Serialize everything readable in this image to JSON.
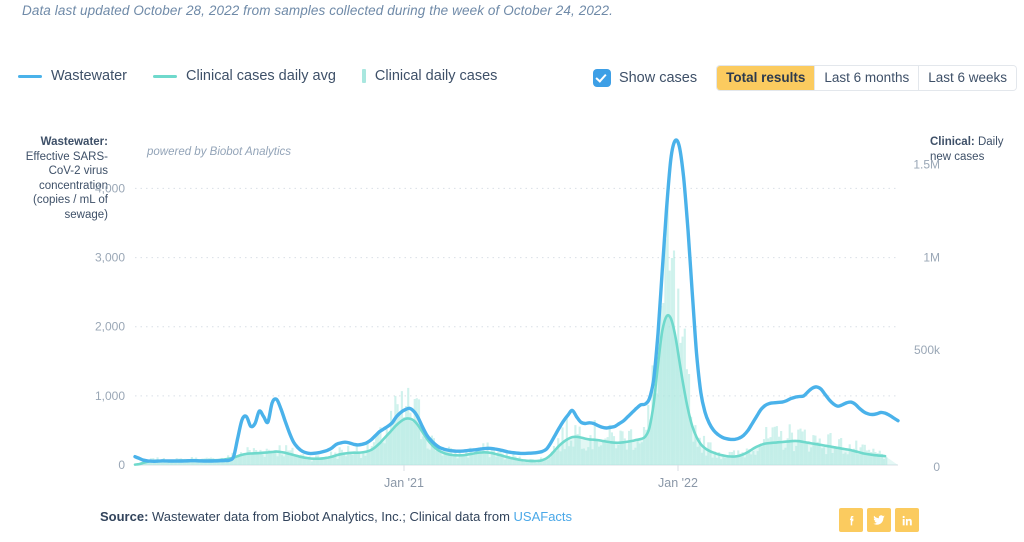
{
  "header": {
    "updated_note": "Data last updated October 28, 2022 from samples collected during the week of October 24, 2022."
  },
  "legend": {
    "items": [
      {
        "label": "Wastewater",
        "marker": "line",
        "color": "#4ab2ea"
      },
      {
        "label": "Clinical cases daily avg",
        "marker": "line",
        "color": "#6fd9cc"
      },
      {
        "label": "Clinical daily cases",
        "marker": "bar",
        "color": "#a9e7df"
      }
    ]
  },
  "controls": {
    "show_cases_label": "Show cases",
    "show_cases_checked": true,
    "range_buttons": [
      {
        "label": "Total results",
        "active": true
      },
      {
        "label": "Last 6 months",
        "active": false
      },
      {
        "label": "Last 6 weeks",
        "active": false
      }
    ],
    "active_color": "#fbcb5f"
  },
  "chart_attribution": "powered by Biobot Analytics",
  "footer": {
    "source_label": "Source:",
    "source_text": " Wastewater data from Biobot Analytics, Inc.; Clinical data from ",
    "source_link": "USAFacts",
    "socials": [
      {
        "name": "facebook-icon"
      },
      {
        "name": "twitter-icon"
      },
      {
        "name": "linkedin-icon"
      }
    ]
  },
  "chart_data": {
    "type": "line",
    "title": "",
    "subtitle": "",
    "xlabel": "",
    "ylabel": "Wastewater: Effective SARS-CoV-2 virus concentration (copies / mL of sewage)",
    "y2label": "Clinical: Daily new cases",
    "ylabel_title_bold": "Wastewater:",
    "ylabel_title_rest": "Effective SARS-CoV-2 virus concentration (copies / mL of sewage)",
    "y2label_title_bold": "Clinical:",
    "y2label_title_rest": "Daily new cases",
    "grid": true,
    "legend_position": "top-left",
    "ylim": [
      0,
      4700
    ],
    "y2lim": [
      0,
      1750000
    ],
    "yticks": [
      0,
      1000,
      2000,
      3000,
      4000
    ],
    "yticklabels": [
      "0",
      "1,000",
      "2,000",
      "3,000",
      "4,000"
    ],
    "y2ticks": [
      0,
      500000,
      1000000,
      1500000
    ],
    "y2ticklabels": [
      "0",
      "500k",
      "1M",
      "1.5M"
    ],
    "xticks": [
      "Jan '21",
      "Jan '22"
    ],
    "xrange": [
      "Mar 2020",
      "Oct 2022"
    ],
    "series": [
      {
        "name": "Wastewater",
        "axis": "left",
        "color": "#4ab2ea",
        "type": "line",
        "units": "copies / mL of sewage",
        "values": [
          120,
          95,
          70,
          60,
          55,
          55,
          60,
          60,
          58,
          58,
          58,
          58,
          60,
          62,
          62,
          60,
          58,
          58,
          58,
          60,
          62,
          65,
          70,
          120,
          400,
          660,
          700,
          560,
          600,
          780,
          700,
          620,
          900,
          950,
          820,
          640,
          470,
          330,
          250,
          200,
          175,
          165,
          170,
          180,
          195,
          215,
          250,
          300,
          320,
          330,
          320,
          300,
          290,
          300,
          320,
          360,
          420,
          480,
          520,
          560,
          610,
          700,
          760,
          800,
          820,
          780,
          690,
          560,
          440,
          360,
          300,
          255,
          230,
          215,
          205,
          200,
          200,
          205,
          212,
          218,
          225,
          235,
          240,
          240,
          232,
          220,
          205,
          190,
          180,
          172,
          168,
          168,
          170,
          175,
          182,
          195,
          230,
          320,
          430,
          540,
          640,
          720,
          790,
          700,
          620,
          600,
          610,
          600,
          570,
          545,
          535,
          545,
          560,
          600,
          640,
          700,
          760,
          820,
          870,
          880,
          960,
          1240,
          1900,
          2800,
          3700,
          4420,
          4690,
          4600,
          4150,
          3400,
          2500,
          1620,
          1050,
          760,
          600,
          500,
          440,
          400,
          380,
          370,
          372,
          390,
          430,
          500,
          600,
          700,
          800,
          860,
          890,
          900,
          905,
          910,
          930,
          960,
          980,
          990,
          1000,
          1060,
          1110,
          1130,
          1100,
          1020,
          940,
          880,
          850,
          870,
          900,
          910,
          880,
          820,
          770,
          740,
          730,
          740,
          760,
          750,
          720,
          680,
          640
        ]
      },
      {
        "name": "Clinical cases daily avg",
        "axis": "right",
        "color": "#6fd9cc",
        "type": "line",
        "units": "daily new cases (7-day avg)",
        "values": [
          2000,
          5000,
          12000,
          18000,
          22000,
          23000,
          22000,
          21000,
          20000,
          20000,
          22000,
          24000,
          25000,
          26000,
          26000,
          25000,
          24000,
          24000,
          25000,
          26000,
          28000,
          30000,
          34000,
          40000,
          48000,
          55000,
          60000,
          62000,
          63000,
          64000,
          66000,
          68000,
          70000,
          72000,
          70000,
          66000,
          60000,
          54000,
          48000,
          42000,
          38000,
          35000,
          34000,
          34000,
          36000,
          40000,
          45000,
          52000,
          58000,
          62000,
          65000,
          66000,
          66000,
          68000,
          72000,
          80000,
          95000,
          115000,
          140000,
          165000,
          190000,
          215000,
          235000,
          248000,
          250000,
          240000,
          215000,
          180000,
          145000,
          115000,
          92000,
          76000,
          65000,
          58000,
          54000,
          52000,
          52000,
          54000,
          58000,
          62000,
          66000,
          68000,
          68000,
          65000,
          60000,
          54000,
          48000,
          42000,
          36000,
          31000,
          27000,
          24000,
          22000,
          21000,
          22000,
          26000,
          36000,
          55000,
          80000,
          105000,
          125000,
          140000,
          150000,
          152000,
          148000,
          142000,
          138000,
          136000,
          134000,
          130000,
          126000,
          122000,
          120000,
          120000,
          122000,
          126000,
          130000,
          135000,
          140000,
          152000,
          200000,
          330000,
          540000,
          720000,
          800000,
          790000,
          700000,
          560000,
          420000,
          300000,
          210000,
          150000,
          112000,
          90000,
          76000,
          66000,
          58000,
          52000,
          48000,
          46000,
          46000,
          50000,
          58000,
          70000,
          85000,
          98000,
          108000,
          115000,
          118000,
          120000,
          122000,
          124000,
          126000,
          128000,
          130000,
          128000,
          124000,
          120000,
          116000,
          112000,
          108000,
          104000,
          100000,
          96000,
          92000,
          88000,
          84000,
          80000,
          74000,
          68000,
          62000,
          58000,
          55000,
          52000,
          50000,
          48000
        ]
      },
      {
        "name": "Clinical daily cases",
        "axis": "right",
        "color": "#a9e7df",
        "type": "bar",
        "units": "daily new cases",
        "note": "daily reported case bars rendered behind the 7-day average line"
      }
    ],
    "annotations": [
      {
        "text": "powered by Biobot Analytics",
        "position": "top-left-inside"
      }
    ]
  }
}
